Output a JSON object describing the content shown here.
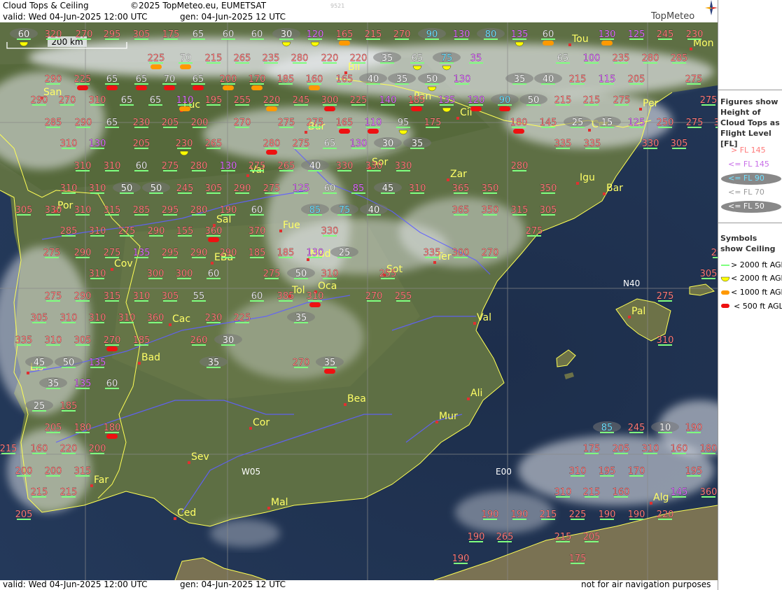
{
  "header": {
    "product": "Cloud Tops & Ceiling",
    "copyright": "©2025 TopMeteo.eu, EUMETSAT",
    "valid": "valid:  Wed  04-Jun-2025  12:00 UTC",
    "generated": "gen: 04-Jun-2025 12 UTC",
    "code": "9521",
    "brand": "TopMeteo"
  },
  "footer": {
    "valid": "valid:  Wed  04-Jun-2025  12:00 UTC",
    "generated": "gen: 04-Jun-2025 12 UTC",
    "disclaimer": "not for air navigation purposes"
  },
  "scale_bar": "200 km",
  "grid_labels": [
    "N40",
    "W05",
    "E00"
  ],
  "cities": [
    "Tou",
    "Mon",
    "Bil",
    "Pan",
    "Per",
    "San",
    "Luc",
    "Cil",
    "Cer",
    "Bur",
    "Sor",
    "Zar",
    "Val",
    "Igu",
    "Bar",
    "Por",
    "Sal",
    "Fue",
    "Mad",
    "EBa",
    "Ter",
    "Cov",
    "Sot",
    "Tol",
    "Oca",
    "Pal",
    "Cac",
    "Val",
    "Bad",
    "Lis",
    "Bea",
    "Ali",
    "Mur",
    "Cor",
    "Sev",
    "Far",
    "Mal",
    "Alg",
    "Ced"
  ],
  "colors": {
    "above_fl145": "#ff7b7b",
    "below_fl145": "#e070ff",
    "below_fl90": "#70e0ff",
    "below_fl70": "#e6e6e6",
    "below_fl50": "#ffffff",
    "ceiling_above_2000": "#7fff7f",
    "ceiling_below_2000": "#ffff00",
    "ceiling_below_1000": "#ff9900",
    "ceiling_below_500": "#ff0000",
    "city": "#ffff66",
    "border": "#ffff55",
    "river": "#6060ff"
  },
  "legend": {
    "figures_title": "Figures show Height of Cloud Tops as Flight Level  [FL]",
    "figures": [
      "> FL 145",
      "<= FL 145",
      "<= FL 90",
      "<= FL 70",
      "<= FL 50"
    ],
    "symbols_title": "Symbols show Ceiling",
    "symbols": [
      "> 2000 ft AGL",
      "< 2000 ft AGL",
      "< 1000 ft AGL",
      "< 500 ft AGL"
    ]
  },
  "cloud_tops": [
    {
      "v": "60",
      "c": "w",
      "s": "y"
    },
    {
      "v": "320",
      "c": "r"
    },
    {
      "v": "270",
      "c": "r"
    },
    {
      "v": "295",
      "c": "r"
    },
    {
      "v": "305",
      "c": "r"
    },
    {
      "v": "175",
      "c": "r"
    },
    {
      "v": "65",
      "c": "l"
    },
    {
      "v": "60",
      "c": "l"
    },
    {
      "v": "60",
      "c": "l"
    },
    {
      "v": "30",
      "c": "w",
      "s": "y"
    },
    {
      "v": "120",
      "c": "p",
      "s": "y"
    },
    {
      "v": "165",
      "c": "r",
      "s": "o"
    },
    {
      "v": "215",
      "c": "r"
    },
    {
      "v": "270",
      "c": "r"
    },
    {
      "v": "90",
      "c": "c"
    },
    {
      "v": "130",
      "c": "p"
    },
    {
      "v": "80",
      "c": "c"
    },
    {
      "v": "135",
      "c": "p",
      "s": "y"
    },
    {
      "v": "60",
      "c": "l",
      "s": "o"
    },
    {
      "v": "130",
      "c": "p",
      "s": "o"
    },
    {
      "v": "125",
      "c": "p"
    },
    {
      "v": "245",
      "c": "r"
    },
    {
      "v": "230",
      "c": "r"
    },
    {
      "v": "225",
      "c": "r",
      "s": "o"
    },
    {
      "v": "70",
      "c": "l",
      "s": "o"
    },
    {
      "v": "215",
      "c": "r"
    },
    {
      "v": "265",
      "c": "r"
    },
    {
      "v": "235",
      "c": "r"
    },
    {
      "v": "280",
      "c": "r"
    },
    {
      "v": "220",
      "c": "r"
    },
    {
      "v": "220",
      "c": "r"
    },
    {
      "v": "35",
      "c": "w"
    },
    {
      "v": "65",
      "c": "l",
      "s": "y"
    },
    {
      "v": "75",
      "c": "c",
      "s": "y"
    },
    {
      "v": "35",
      "c": "p"
    },
    {
      "v": "65",
      "c": "l"
    },
    {
      "v": "100",
      "c": "p"
    },
    {
      "v": "235",
      "c": "r"
    },
    {
      "v": "280",
      "c": "r"
    },
    {
      "v": "285",
      "c": "r"
    },
    {
      "v": "290",
      "c": "r"
    },
    {
      "v": "225",
      "c": "r",
      "s": "r"
    },
    {
      "v": "65",
      "c": "l",
      "s": "r"
    },
    {
      "v": "65",
      "c": "l",
      "s": "r"
    },
    {
      "v": "70",
      "c": "l",
      "s": "r"
    },
    {
      "v": "65",
      "c": "l",
      "s": "r"
    },
    {
      "v": "200",
      "c": "r",
      "s": "o"
    },
    {
      "v": "170",
      "c": "r",
      "s": "o"
    },
    {
      "v": "185",
      "c": "r"
    },
    {
      "v": "160",
      "c": "r",
      "s": "o"
    },
    {
      "v": "165",
      "c": "r"
    },
    {
      "v": "40",
      "c": "w"
    },
    {
      "v": "35",
      "c": "w"
    },
    {
      "v": "50",
      "c": "w",
      "s": "y"
    },
    {
      "v": "130",
      "c": "p"
    },
    {
      "v": "35",
      "c": "w"
    },
    {
      "v": "40",
      "c": "w"
    },
    {
      "v": "215",
      "c": "r"
    },
    {
      "v": "115",
      "c": "p"
    },
    {
      "v": "205",
      "c": "r"
    },
    {
      "v": "275",
      "c": "r"
    },
    {
      "v": "290",
      "c": "r"
    },
    {
      "v": "270",
      "c": "r"
    },
    {
      "v": "310",
      "c": "r"
    },
    {
      "v": "65",
      "c": "l"
    },
    {
      "v": "65",
      "c": "l"
    },
    {
      "v": "110",
      "c": "p",
      "s": "o"
    },
    {
      "v": "195",
      "c": "r"
    },
    {
      "v": "255",
      "c": "r"
    },
    {
      "v": "220",
      "c": "r",
      "s": "o"
    },
    {
      "v": "245",
      "c": "r"
    },
    {
      "v": "300",
      "c": "r",
      "s": "r"
    },
    {
      "v": "225",
      "c": "r"
    },
    {
      "v": "140",
      "c": "p"
    },
    {
      "v": "185",
      "c": "r",
      "s": "r"
    },
    {
      "v": "135",
      "c": "p",
      "s": "y"
    },
    {
      "v": "120",
      "c": "p",
      "s": "r"
    },
    {
      "v": "90",
      "c": "c",
      "s": "r"
    },
    {
      "v": "50",
      "c": "w"
    },
    {
      "v": "215",
      "c": "r"
    },
    {
      "v": "215",
      "c": "r"
    },
    {
      "v": "275",
      "c": "r"
    },
    {
      "v": "275",
      "c": "r"
    },
    {
      "v": "285",
      "c": "r"
    },
    {
      "v": "290",
      "c": "r"
    },
    {
      "v": "65",
      "c": "l"
    },
    {
      "v": "230",
      "c": "r"
    },
    {
      "v": "205",
      "c": "r"
    },
    {
      "v": "200",
      "c": "r"
    },
    {
      "v": "270",
      "c": "r"
    },
    {
      "v": "275",
      "c": "r"
    },
    {
      "v": "275",
      "c": "r"
    },
    {
      "v": "165",
      "c": "r",
      "s": "r"
    },
    {
      "v": "110",
      "c": "p",
      "s": "r"
    },
    {
      "v": "95",
      "c": "l",
      "s": "y"
    },
    {
      "v": "175",
      "c": "r"
    },
    {
      "v": "180",
      "c": "r",
      "s": "r"
    },
    {
      "v": "145",
      "c": "r"
    },
    {
      "v": "25",
      "c": "w"
    },
    {
      "v": "15",
      "c": "w"
    },
    {
      "v": "125",
      "c": "p"
    },
    {
      "v": "250",
      "c": "r"
    },
    {
      "v": "275",
      "c": "r"
    },
    {
      "v": "305",
      "c": "r"
    },
    {
      "v": "310",
      "c": "r"
    },
    {
      "v": "130",
      "c": "p"
    },
    {
      "v": "205",
      "c": "r"
    },
    {
      "v": "230",
      "c": "r",
      "s": "y"
    },
    {
      "v": "265",
      "c": "r"
    },
    {
      "v": "280",
      "c": "r",
      "s": "r"
    },
    {
      "v": "275",
      "c": "r"
    },
    {
      "v": "65",
      "c": "l"
    },
    {
      "v": "130",
      "c": "p"
    },
    {
      "v": "30",
      "c": "w"
    },
    {
      "v": "35",
      "c": "w"
    },
    {
      "v": "335",
      "c": "r"
    },
    {
      "v": "335",
      "c": "r"
    },
    {
      "v": "330",
      "c": "r"
    },
    {
      "v": "305",
      "c": "r"
    },
    {
      "v": "310",
      "c": "r"
    },
    {
      "v": "310",
      "c": "r"
    },
    {
      "v": "60",
      "c": "l"
    },
    {
      "v": "275",
      "c": "r"
    },
    {
      "v": "280",
      "c": "r"
    },
    {
      "v": "130",
      "c": "p"
    },
    {
      "v": "275",
      "c": "r"
    },
    {
      "v": "265",
      "c": "r"
    },
    {
      "v": "40",
      "c": "w"
    },
    {
      "v": "330",
      "c": "r"
    },
    {
      "v": "330",
      "c": "r"
    },
    {
      "v": "330",
      "c": "r"
    },
    {
      "v": "280",
      "c": "r"
    },
    {
      "v": "310",
      "c": "r"
    },
    {
      "v": "310",
      "c": "r"
    },
    {
      "v": "50",
      "c": "w"
    },
    {
      "v": "50",
      "c": "w"
    },
    {
      "v": "245",
      "c": "r"
    },
    {
      "v": "305",
      "c": "r"
    },
    {
      "v": "290",
      "c": "r"
    },
    {
      "v": "275",
      "c": "r"
    },
    {
      "v": "125",
      "c": "p"
    },
    {
      "v": "60",
      "c": "l"
    },
    {
      "v": "85",
      "c": "p"
    },
    {
      "v": "45",
      "c": "w"
    },
    {
      "v": "310",
      "c": "r"
    },
    {
      "v": "365",
      "c": "r"
    },
    {
      "v": "350",
      "c": "r"
    },
    {
      "v": "350",
      "c": "r"
    },
    {
      "v": "305",
      "c": "r"
    },
    {
      "v": "330",
      "c": "r"
    },
    {
      "v": "310",
      "c": "r"
    },
    {
      "v": "315",
      "c": "r"
    },
    {
      "v": "285",
      "c": "r"
    },
    {
      "v": "295",
      "c": "r"
    },
    {
      "v": "280",
      "c": "r"
    },
    {
      "v": "190",
      "c": "r"
    },
    {
      "v": "60",
      "c": "l"
    },
    {
      "v": "85",
      "c": "c"
    },
    {
      "v": "75",
      "c": "c"
    },
    {
      "v": "40",
      "c": "w"
    },
    {
      "v": "365",
      "c": "r"
    },
    {
      "v": "350",
      "c": "r"
    },
    {
      "v": "315",
      "c": "r"
    },
    {
      "v": "305",
      "c": "r"
    },
    {
      "v": "285",
      "c": "r"
    },
    {
      "v": "310",
      "c": "r"
    },
    {
      "v": "275",
      "c": "r"
    },
    {
      "v": "290",
      "c": "r"
    },
    {
      "v": "155",
      "c": "r"
    },
    {
      "v": "360",
      "c": "r",
      "s": "r"
    },
    {
      "v": "370",
      "c": "r"
    },
    {
      "v": "330",
      "c": "r"
    },
    {
      "v": "275",
      "c": "r"
    },
    {
      "v": "275",
      "c": "r"
    },
    {
      "v": "290",
      "c": "r"
    },
    {
      "v": "275",
      "c": "r"
    },
    {
      "v": "135",
      "c": "p"
    },
    {
      "v": "295",
      "c": "r"
    },
    {
      "v": "290",
      "c": "r"
    },
    {
      "v": "290",
      "c": "r"
    },
    {
      "v": "185",
      "c": "r"
    },
    {
      "v": "185",
      "c": "r"
    },
    {
      "v": "130",
      "c": "p"
    },
    {
      "v": "25",
      "c": "w"
    },
    {
      "v": "335",
      "c": "r"
    },
    {
      "v": "300",
      "c": "r"
    },
    {
      "v": "270",
      "c": "r"
    },
    {
      "v": "290",
      "c": "r"
    },
    {
      "v": "310",
      "c": "r"
    },
    {
      "v": "300",
      "c": "r"
    },
    {
      "v": "300",
      "c": "r"
    },
    {
      "v": "60",
      "c": "l"
    },
    {
      "v": "275",
      "c": "r"
    },
    {
      "v": "50",
      "c": "w"
    },
    {
      "v": "310",
      "c": "r"
    },
    {
      "v": "255",
      "c": "r"
    },
    {
      "v": "305",
      "c": "r"
    },
    {
      "v": "275",
      "c": "r"
    },
    {
      "v": "290",
      "c": "r"
    },
    {
      "v": "315",
      "c": "r"
    },
    {
      "v": "310",
      "c": "r"
    },
    {
      "v": "305",
      "c": "r"
    },
    {
      "v": "55",
      "c": "l"
    },
    {
      "v": "60",
      "c": "l"
    },
    {
      "v": "385",
      "c": "r"
    },
    {
      "v": "310",
      "c": "r",
      "s": "r"
    },
    {
      "v": "270",
      "c": "r"
    },
    {
      "v": "255",
      "c": "r"
    },
    {
      "v": "275",
      "c": "r"
    },
    {
      "v": "305",
      "c": "r"
    },
    {
      "v": "310",
      "c": "r"
    },
    {
      "v": "310",
      "c": "r"
    },
    {
      "v": "310",
      "c": "r"
    },
    {
      "v": "360",
      "c": "r"
    },
    {
      "v": "230",
      "c": "r"
    },
    {
      "v": "225",
      "c": "r"
    },
    {
      "v": "35",
      "c": "w"
    },
    {
      "v": "335",
      "c": "r"
    },
    {
      "v": "310",
      "c": "r"
    },
    {
      "v": "305",
      "c": "r"
    },
    {
      "v": "270",
      "c": "r",
      "s": "r"
    },
    {
      "v": "185",
      "c": "r"
    },
    {
      "v": "260",
      "c": "r"
    },
    {
      "v": "30",
      "c": "w"
    },
    {
      "v": "310",
      "c": "r"
    },
    {
      "v": "45",
      "c": "w"
    },
    {
      "v": "50",
      "c": "w"
    },
    {
      "v": "135",
      "c": "p"
    },
    {
      "v": "35",
      "c": "w"
    },
    {
      "v": "270",
      "c": "r"
    },
    {
      "v": "35",
      "c": "w",
      "s": "r"
    },
    {
      "v": "35",
      "c": "w"
    },
    {
      "v": "135",
      "c": "p"
    },
    {
      "v": "60",
      "c": "l"
    },
    {
      "v": "25",
      "c": "w"
    },
    {
      "v": "185",
      "c": "r"
    },
    {
      "v": "205",
      "c": "r"
    },
    {
      "v": "180",
      "c": "r"
    },
    {
      "v": "180",
      "c": "r",
      "s": "r"
    },
    {
      "v": "85",
      "c": "c"
    },
    {
      "v": "245",
      "c": "r"
    },
    {
      "v": "10",
      "c": "w"
    },
    {
      "v": "190",
      "c": "r"
    },
    {
      "v": "160",
      "c": "r"
    },
    {
      "v": "220",
      "c": "r"
    },
    {
      "v": "200",
      "c": "r"
    },
    {
      "v": "215",
      "c": "r"
    },
    {
      "v": "175",
      "c": "r"
    },
    {
      "v": "205",
      "c": "r"
    },
    {
      "v": "310",
      "c": "r"
    },
    {
      "v": "160",
      "c": "r"
    },
    {
      "v": "180",
      "c": "r"
    },
    {
      "v": "200",
      "c": "r"
    },
    {
      "v": "200",
      "c": "r"
    },
    {
      "v": "315",
      "c": "r"
    },
    {
      "v": "310",
      "c": "r"
    },
    {
      "v": "195",
      "c": "r"
    },
    {
      "v": "170",
      "c": "r"
    },
    {
      "v": "195",
      "c": "r"
    },
    {
      "v": "215",
      "c": "r"
    },
    {
      "v": "215",
      "c": "r"
    },
    {
      "v": "310",
      "c": "r"
    },
    {
      "v": "215",
      "c": "r"
    },
    {
      "v": "160",
      "c": "r"
    },
    {
      "v": "145",
      "c": "p"
    },
    {
      "v": "360",
      "c": "r"
    },
    {
      "v": "205",
      "c": "r"
    },
    {
      "v": "190",
      "c": "r"
    },
    {
      "v": "190",
      "c": "r"
    },
    {
      "v": "215",
      "c": "r"
    },
    {
      "v": "225",
      "c": "r"
    },
    {
      "v": "190",
      "c": "r"
    },
    {
      "v": "190",
      "c": "r"
    },
    {
      "v": "220",
      "c": "r"
    },
    {
      "v": "190",
      "c": "r"
    },
    {
      "v": "265",
      "c": "r"
    },
    {
      "v": "215",
      "c": "r"
    },
    {
      "v": "205",
      "c": "r"
    },
    {
      "v": "190",
      "c": "r"
    },
    {
      "v": "175",
      "c": "r"
    }
  ]
}
